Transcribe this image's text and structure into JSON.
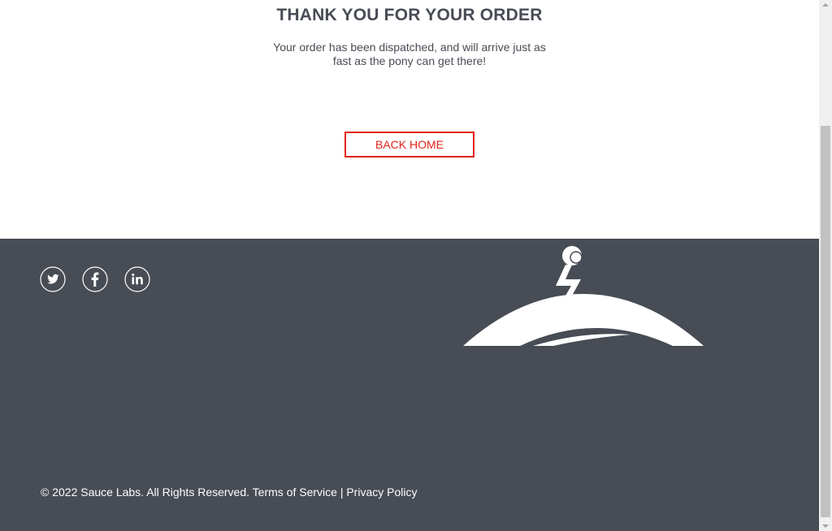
{
  "checkout_complete": {
    "header": "THANK YOU FOR YOUR ORDER",
    "text_line1": "Your order has been dispatched, and will arrive just as",
    "text_line2": "fast as the pony can get there!",
    "back_button_label": "BACK HOME"
  },
  "footer": {
    "social": [
      {
        "icon": "twitter-icon"
      },
      {
        "icon": "facebook-icon"
      },
      {
        "icon": "linkedin-icon"
      }
    ],
    "copyright": "© 2022 Sauce Labs. All Rights Reserved.",
    "terms_label": "Terms of Service",
    "separator": "|",
    "privacy_label": "Privacy Policy"
  },
  "colors": {
    "accent": "#e2231a",
    "text": "#484c55",
    "footer_bg": "#474c55"
  }
}
